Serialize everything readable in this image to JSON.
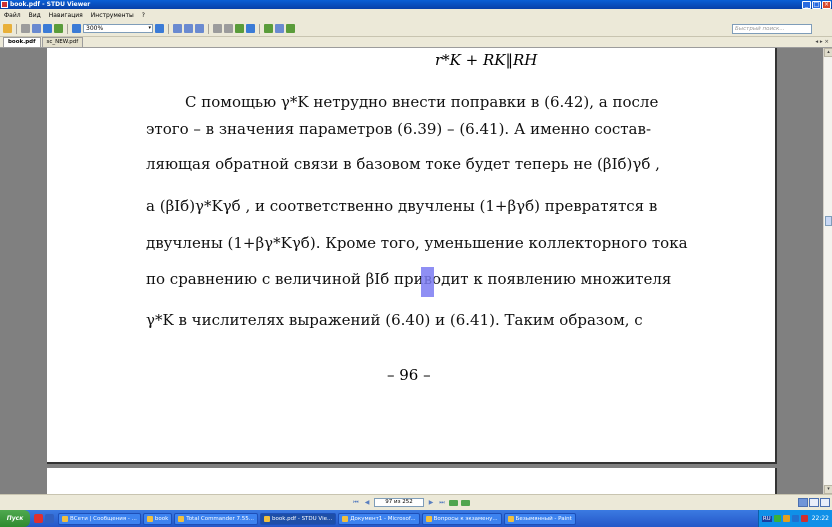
{
  "window": {
    "title": "book.pdf - STDU Viewer",
    "controls": [
      "_",
      "□",
      "×"
    ]
  },
  "menu": {
    "items": [
      "Файл",
      "Вид",
      "Навигация",
      "Инструменты",
      "?"
    ]
  },
  "toolbar": {
    "zoom_value": "300%",
    "search_placeholder": "Быстрый поиск..."
  },
  "tabs": [
    {
      "label": "book.pdf",
      "active": true
    },
    {
      "label": "sc_NEW.pdf",
      "active": false
    }
  ],
  "tab_nav": "◂ ▸ ×",
  "document": {
    "formula_top": "r*K + RK‖RH",
    "lines": [
      "С помощью γ*K нетрудно внести поправки в (6.42), а после",
      "этого – в значения параметров (6.39) – (6.41). А именно состав-",
      "ляющая обратной связи в базовом токе будет теперь не (βIб)γб ,",
      "а (βIб)γ*Kγб , и соответственно двучлены (1+βγб) превратятся в",
      "двучлены (1+βγ*Kγб). Кроме того, уменьшение коллекторного тока",
      "по сравнению с величиной βIб приводит к появлению множителя",
      "γ*K  в числителях выражений (6.40) и (6.41). Таким образом, с"
    ],
    "page_number": "– 96 –"
  },
  "navigation": {
    "page_indicator": "97 из 252"
  },
  "taskbar": {
    "start_label": "Пуск",
    "tasks": [
      {
        "label": "ВСети | Сообщения - ...",
        "active": false
      },
      {
        "label": "book",
        "active": false
      },
      {
        "label": "Total Commander 7.55...",
        "active": false
      },
      {
        "label": "book.pdf - STDU Vie...",
        "active": true
      },
      {
        "label": "Документ1 - Microsof...",
        "active": false
      },
      {
        "label": "Вопросы к экзамену...",
        "active": false
      },
      {
        "label": "Безымянный - Paint",
        "active": false
      }
    ],
    "language": "RU",
    "clock": "22:22"
  },
  "colors": {
    "title_bar": "#0a5fd6",
    "viewer_background": "#808080",
    "page_background": "#ffffff",
    "text_cursor": "#7b7bf2",
    "taskbar": "#2457c8"
  }
}
